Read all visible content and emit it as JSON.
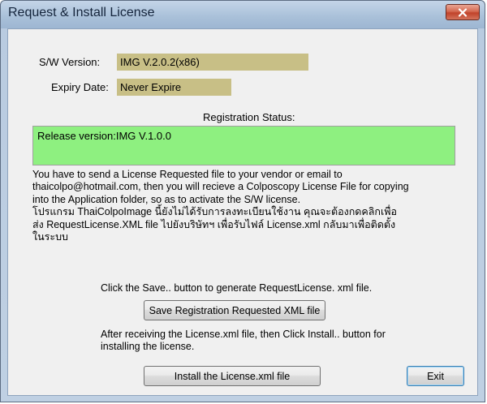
{
  "window": {
    "title": "Request & Install License"
  },
  "version": {
    "label": "S/W Version:",
    "value": "IMG V.2.0.2(x86)"
  },
  "expiry": {
    "label": "Expiry Date:",
    "value": "Never Expire"
  },
  "registration": {
    "label": "Registration Status:",
    "status_text": "Release version:IMG V.1.0.0"
  },
  "info": {
    "line1": "You have to send a License Requested file to your vendor or email to",
    "line2": "thaicolpo@hotmail.com, then you will recieve a Colposcopy License File for copying",
    "line3": "into the Application folder, so as to activate the S/W license.",
    "line4": "โปรแกรม ThaiColpoImage นี้ยังไม่ได้รับการลงทะเบียนใช้งาน คุณจะต้องกดคลิกเพื่อ",
    "line5": "ส่ง RequestLicense.XML file ไปยังบริษัทฯ เพื่อรับไฟล์ License.xml กลับมาเพื่อติดตั้ง",
    "line6": "ในระบบ"
  },
  "save": {
    "hint": "Click the Save.. button to generate RequestLicense. xml file.",
    "button_label": "Save Registration Requested XML file"
  },
  "install": {
    "hint_line1": "After receiving the License.xml file, then Click Install.. button for",
    "hint_line2": "installing the license.",
    "button_label": "Install the License.xml file"
  },
  "exit": {
    "button_label": "Exit"
  },
  "colors": {
    "field_bg": "#c8bf86",
    "status_bg": "#8ef080",
    "close_btn": "#c0432b"
  },
  "icons": {
    "close": "close-icon"
  }
}
